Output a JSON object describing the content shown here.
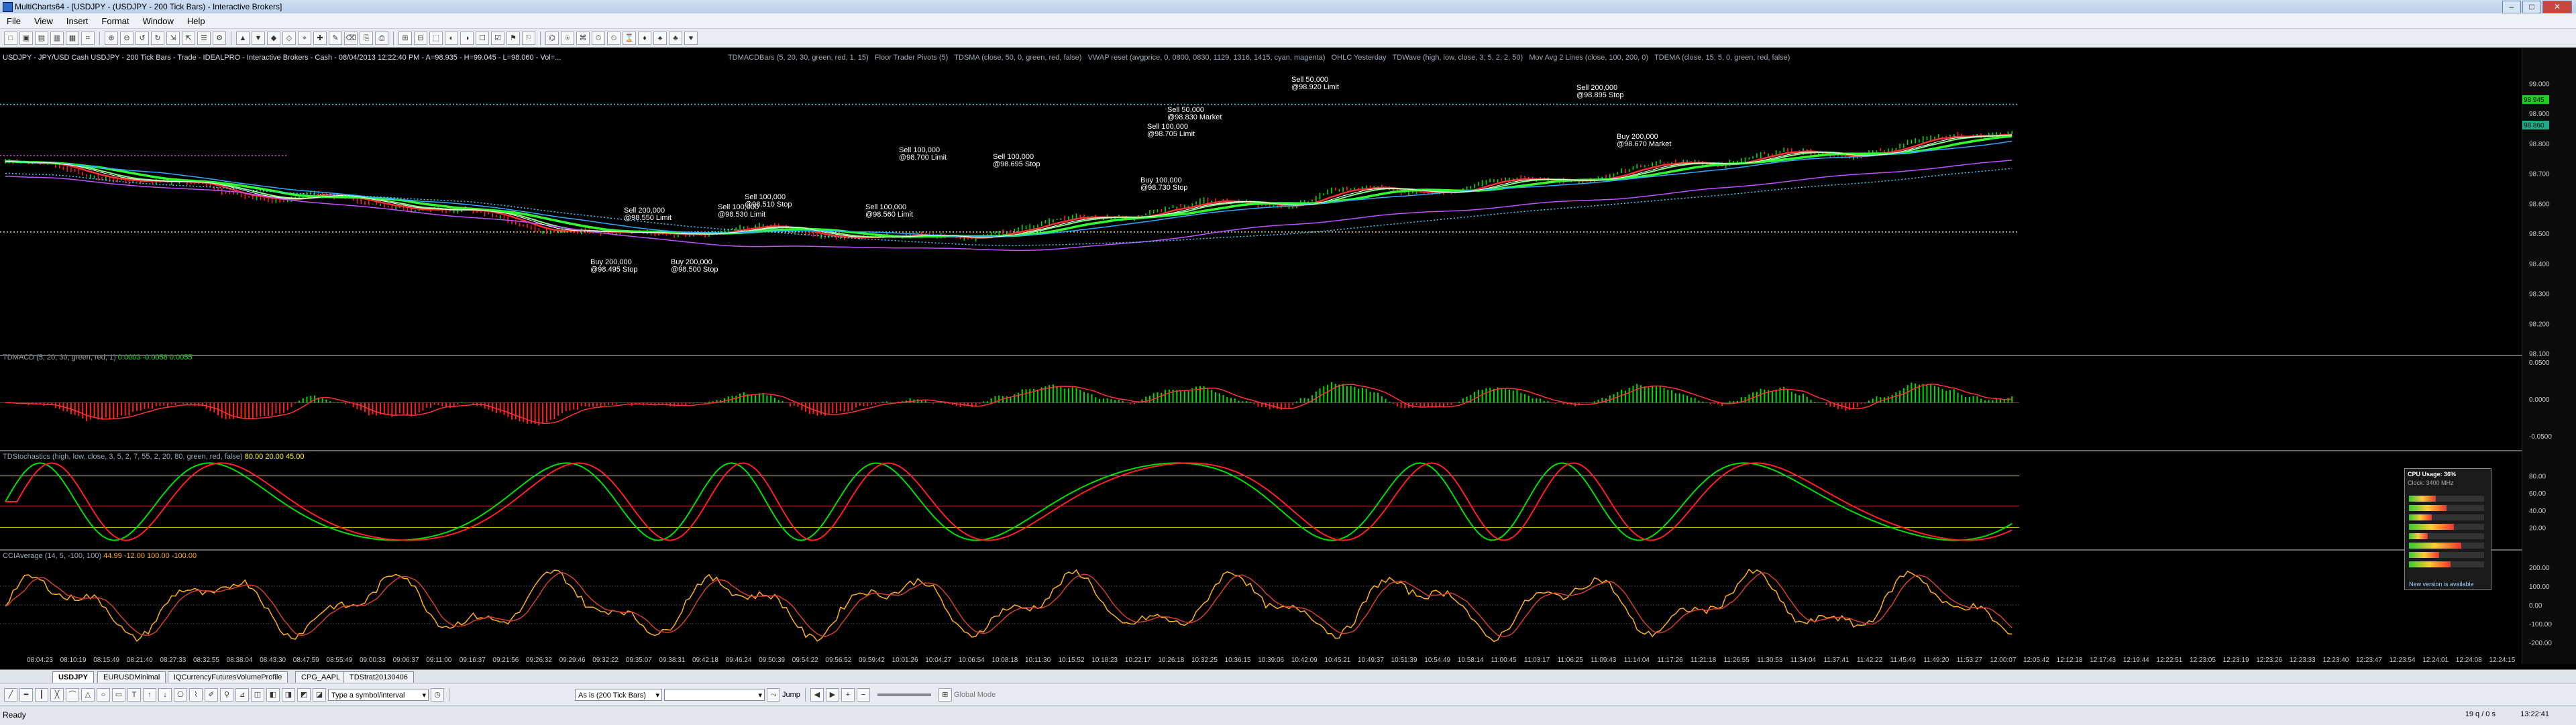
{
  "window": {
    "title": "MultiCharts64 - [USDJPY - (USDJPY - 200 Tick Bars) - Interactive Brokers]"
  },
  "menu": [
    "File",
    "View",
    "Insert",
    "Format",
    "Window",
    "Help"
  ],
  "chart_header": "USDJPY - JPY/USD Cash USDJPY - 200 Tick Bars - Trade - IDEALPRO - Interactive Brokers - Cash - 08/04/2013 12:22:40 PM - A=98.935 - H=99.045 - L=98.060 - Vol=...",
  "price_studies": [
    "TDMACDBars (5, 20, 30, green, red, 1, 15)",
    "Floor Trader Pivots (5)",
    "TDSMA (close, 50, 0, green, red, false)",
    "VWAP reset (avgprice, 0, 0800, 0830, 1129, 1316, 1415, cyan, magenta)",
    "OHLC Yesterday",
    "TDWave (high, low, close, 3, 5, 2, 2, 50)",
    "Mov Avg 2 Lines (close, 100, 200, 0)",
    "TDEMA (close, 15, 5, 0, green, red, false)"
  ],
  "price_axis": [
    "99.000",
    "98.900",
    "98.800",
    "98.700",
    "98.600",
    "98.500",
    "98.400",
    "98.300",
    "98.200",
    "98.100"
  ],
  "price_tags": {
    "last": "98.945",
    "other": "98.860"
  },
  "trade_annotations": [
    {
      "label": "Sell 50,000",
      "sub": "@98.920 Limit"
    },
    {
      "label": "Sell 200,000",
      "sub": "@98.895 Stop"
    },
    {
      "label": "Buy 200,000",
      "sub": "@98.670 Market"
    },
    {
      "label": "Sell 50,000",
      "sub": "@98.830 Market"
    },
    {
      "label": "Sell 100,000",
      "sub": "@98.705 Limit"
    },
    {
      "label": "Sell 100,000",
      "sub": "@98.695 Stop"
    },
    {
      "label": "Sell 100,000",
      "sub": "@98.700 Limit"
    },
    {
      "label": "Buy 100,000",
      "sub": "@98.730 Stop"
    },
    {
      "label": "Sell 100,000",
      "sub": "@98.560 Limit"
    },
    {
      "label": "Sell 100,000",
      "sub": "@98.530 Limit"
    },
    {
      "label": "Sell 100,000",
      "sub": "@98.510 Stop"
    },
    {
      "label": "Sell 200,000",
      "sub": "@98.550 Limit"
    },
    {
      "label": "Buy 200,000",
      "sub": "@98.495 Stop"
    },
    {
      "label": "Buy 200,000",
      "sub": "@98.500 Stop"
    }
  ],
  "panes": {
    "macd": {
      "label": "TDMACD (5, 20, 30, green, red, 1)",
      "values": "0.0003  -0.0058  0.0055",
      "axis": [
        "0.0500",
        "0.0000",
        "-0.0500"
      ]
    },
    "stoch": {
      "label": "TDStochastics (high, low, close, 3, 5, 2, 7, 55, 2, 20, 80, green, red, false)",
      "values": "80.00  20.00  45.00",
      "axis": [
        "80.00",
        "60.00",
        "40.00",
        "20.00"
      ]
    },
    "cci": {
      "label": "CCIAverage (14, 5, -100, 100)",
      "values": "44.99  -12.00  100.00  -100.00",
      "axis": [
        "200.00",
        "100.00",
        "0.00",
        "-100.00",
        "-200.00"
      ]
    }
  },
  "time_axis": [
    "08:04:23",
    "08:10:19",
    "08:15:49",
    "08:21:40",
    "08:27:33",
    "08:32:55",
    "08:38:04",
    "08:43:30",
    "08:47:59",
    "08:55:49",
    "09:00:33",
    "09:06:37",
    "09:11:00",
    "09:16:37",
    "09:21:56",
    "09:26:32",
    "09:29:46",
    "09:32:22",
    "09:35:07",
    "09:38:31",
    "09:42:18",
    "09:46:24",
    "09:50:39",
    "09:54:22",
    "09:56:52",
    "09:59:42",
    "10:01:26",
    "10:04:27",
    "10:06:54",
    "10:08:18",
    "10:11:30",
    "10:15:52",
    "10:18:23",
    "10:22:17",
    "10:26:18",
    "10:32:25",
    "10:36:15",
    "10:39:06",
    "10:42:09",
    "10:45:21",
    "10:49:37",
    "10:51:39",
    "10:54:49",
    "10:58:14",
    "11:00:45",
    "11:03:17",
    "11:06:25",
    "11:09:43",
    "11:14:04",
    "11:17:26",
    "11:21:18",
    "11:26:55",
    "11:30:53",
    "11:34:04",
    "11:37:41",
    "11:42:22",
    "11:45:49",
    "11:49:20",
    "11:53:27",
    "12:00:07",
    "12:05:42",
    "12:12:18",
    "12:17:43",
    "12:19:44",
    "12:22:51",
    "12:23:05",
    "12:23:19",
    "12:23:26",
    "12:23:33",
    "12:23:40",
    "12:23:47",
    "12:23:54",
    "12:24:01",
    "12:24:08",
    "12:24:15"
  ],
  "tabs": [
    "USDJPY",
    "EURUSDMinimal",
    "IQCurrencyFuturesVolumeProfile",
    "CPG_AAPL",
    "TDStrat20130406"
  ],
  "drawbar": {
    "symbol_placeholder": "Type a symbol/interval",
    "resolution": "As is (200 Tick Bars)",
    "jump": "Jump",
    "global_mode": "Global Mode"
  },
  "status": {
    "left": "Ready",
    "right1": "19 q / 0 s",
    "clock": "13:22:41"
  },
  "cpu_widget": {
    "title": "CPU Usage: 36%",
    "sub": "Clock: 3400 MHz",
    "footer": "New version is available"
  },
  "colors": {
    "up": "#00e000",
    "down": "#ff2020",
    "cyan": "#39d3ff",
    "magenta": "#d040d0",
    "yellow": "#f0e040"
  }
}
